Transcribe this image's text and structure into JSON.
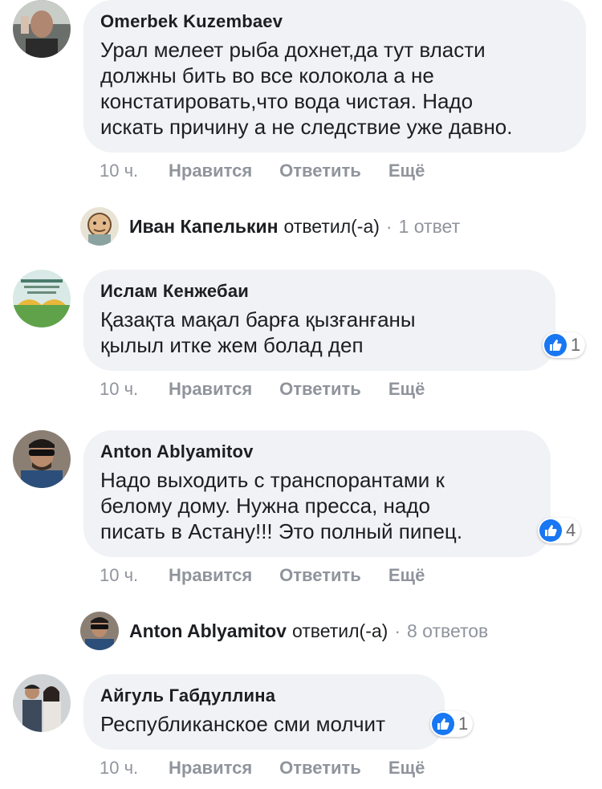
{
  "comments": [
    {
      "author": "Omerbek Kuzembaev",
      "text": "Урал мелеет рыба дохнет,да тут власти\nдолжны бить во все колокола а не\nконстатировать,что вода чистая. Надо\nискать причину а не следствие уже давно.",
      "time": "10 ч.",
      "like": "Нравится",
      "reply": "Ответить",
      "more": "Ещё",
      "reactions": null
    },
    {
      "author": "Ислам Кенжебаи",
      "text": "Қазақта мақал барға қызғанғаны\nқылыл итке жем болад деп",
      "time": "10 ч.",
      "like": "Нравится",
      "reply": "Ответить",
      "more": "Ещё",
      "reactions": "1"
    },
    {
      "author": "Anton Ablyamitov",
      "text": "Надо выходить с транспорантами к\nбелому дому. Нужна пресса, надо\nписать в Астану!!! Это полный пипец.",
      "time": "10 ч.",
      "like": "Нравится",
      "reply": "Ответить",
      "more": "Ещё",
      "reactions": "4"
    },
    {
      "author": "Айгуль Габдуллина",
      "text": "Республиканское сми молчит",
      "time": "10 ч.",
      "like": "Нравится",
      "reply": "Ответить",
      "more": "Ещё",
      "reactions": "1"
    }
  ],
  "replies": [
    {
      "name": "Иван Капелькин",
      "verb": "ответил(-а)",
      "dot": "·",
      "count": "1 ответ"
    },
    {
      "name": "Anton Ablyamitov",
      "verb": "ответил(-а)",
      "dot": "·",
      "count": "8 ответов"
    }
  ],
  "colors": {
    "bubble": "#f0f2f5",
    "meta": "#90949c",
    "like_blue": "#1877f2"
  }
}
